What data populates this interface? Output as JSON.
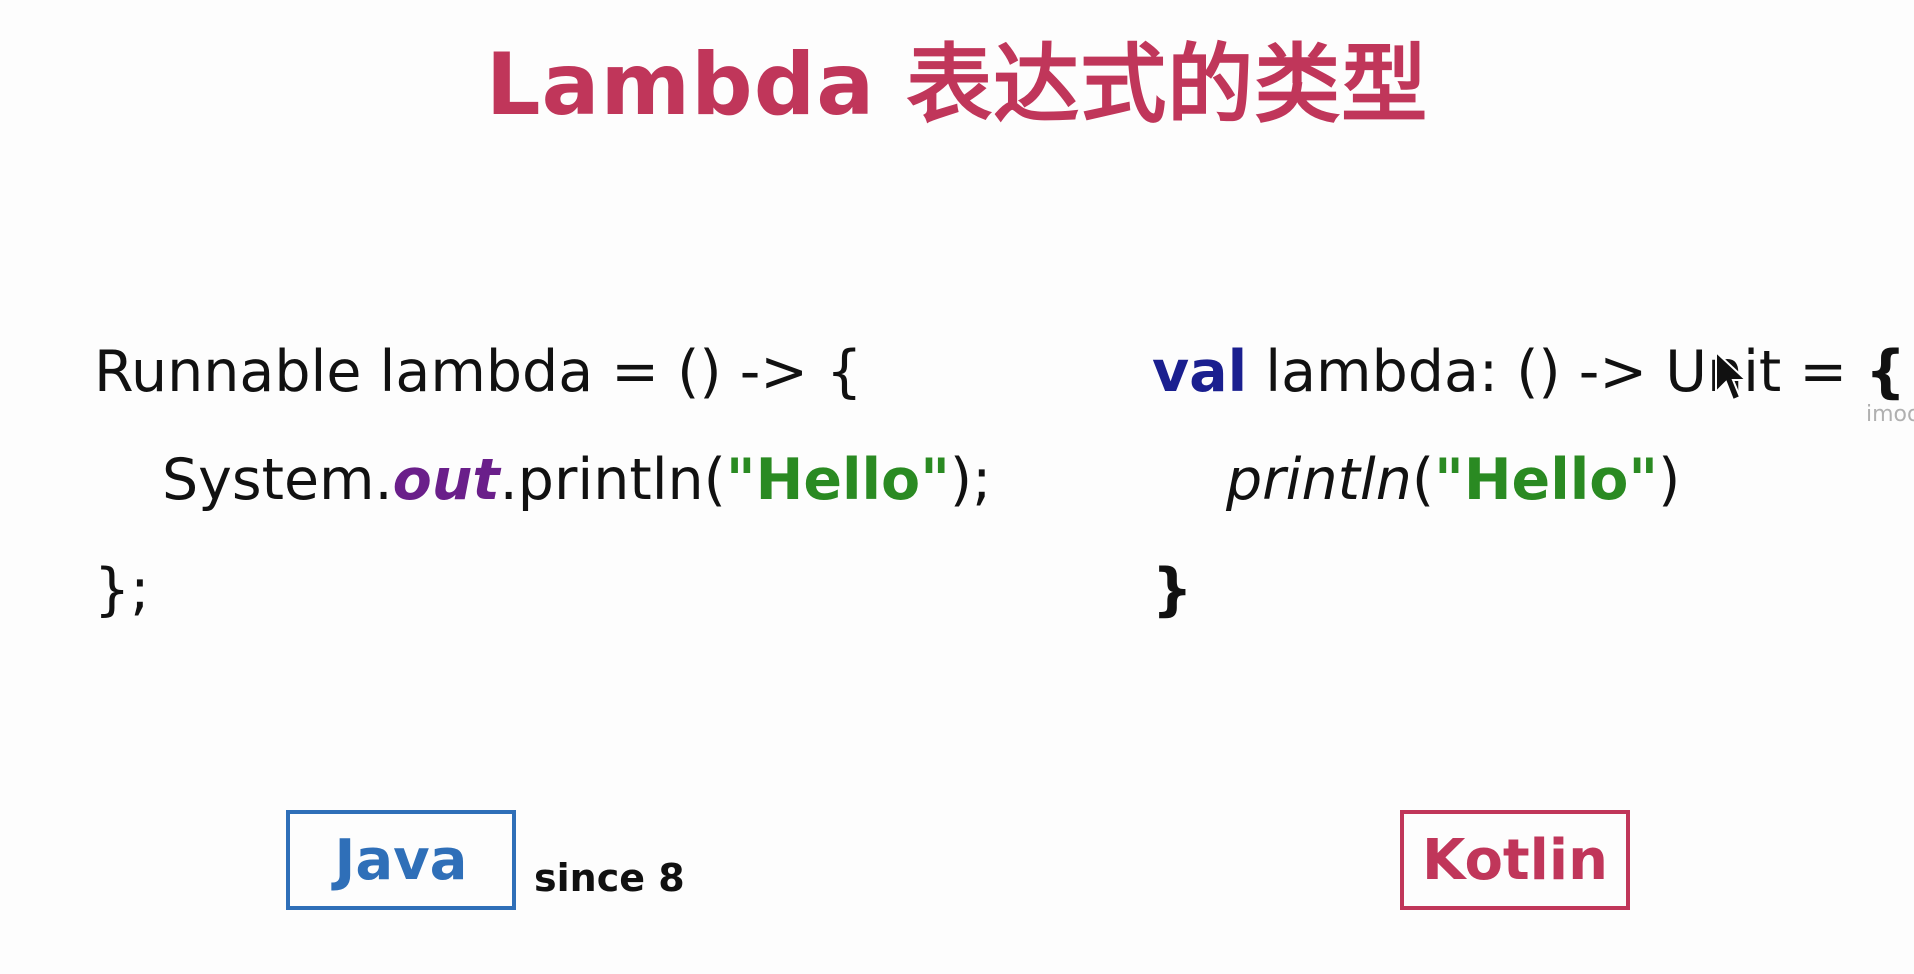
{
  "slide": {
    "title": "Lambda 表达式的类型"
  },
  "java": {
    "line1": "Runnable lambda = () -> {",
    "line2_prefix": "System.",
    "line2_out": "out",
    "line2_mid": ".println(",
    "line2_str": "\"Hello\"",
    "line2_suffix": ");",
    "line3": "};",
    "badge_label": "Java",
    "since_label": "since 8"
  },
  "kotlin": {
    "line1_val": "val",
    "line1_rest": " lambda: () -> Unit = ",
    "line1_brace": "{",
    "line2_fn": "println",
    "line2_open": "(",
    "line2_str": "\"Hello\"",
    "line2_close": ")",
    "line3": "}",
    "badge_label": "Kotlin"
  },
  "watermark": "imoo",
  "colors": {
    "title": "#c0365a",
    "java": "#2f6fb8",
    "kotlin": "#c0365a",
    "string": "#2a8a22",
    "keyword_val": "#1a1f8f",
    "field_out": "#6a1f8a"
  }
}
